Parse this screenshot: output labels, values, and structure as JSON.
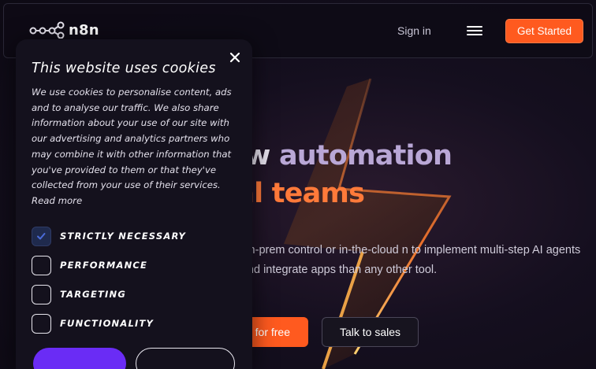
{
  "header": {
    "logo_text": "n8n",
    "sign_in": "Sign in",
    "get_started": "Get Started"
  },
  "hero": {
    "headline_part1": "orkflow",
    "headline_part2": " automation",
    "headline_line2": "chnical teams",
    "subtitle": "ed of drag-n-drop. Host with on-prem control or in-the-cloud n to implement multi-step AI agents and integrate apps than any other tool.",
    "primary_button": "for free",
    "secondary_button": "Talk to sales"
  },
  "cookie_banner": {
    "title": "This website uses cookies",
    "body": "We use cookies to personalise content, ads and to analyse our traffic. We also share information about your use of our site with our advertising and analytics partners who may combine it with other information that you've provided to them or that they've collected from your use of their services. Read more",
    "options": [
      {
        "label": "STRICTLY NECESSARY",
        "checked": true
      },
      {
        "label": "PERFORMANCE",
        "checked": false
      },
      {
        "label": "TARGETING",
        "checked": false
      },
      {
        "label": "FUNCTIONALITY",
        "checked": false
      }
    ]
  },
  "colors": {
    "accent_orange": "#ff5a1f",
    "accent_purple": "#6a2cf5",
    "background": "#0e0b16"
  },
  "icons": [
    "n8n-logo-icon",
    "hamburger-menu-icon",
    "close-icon",
    "checkmark-icon"
  ]
}
